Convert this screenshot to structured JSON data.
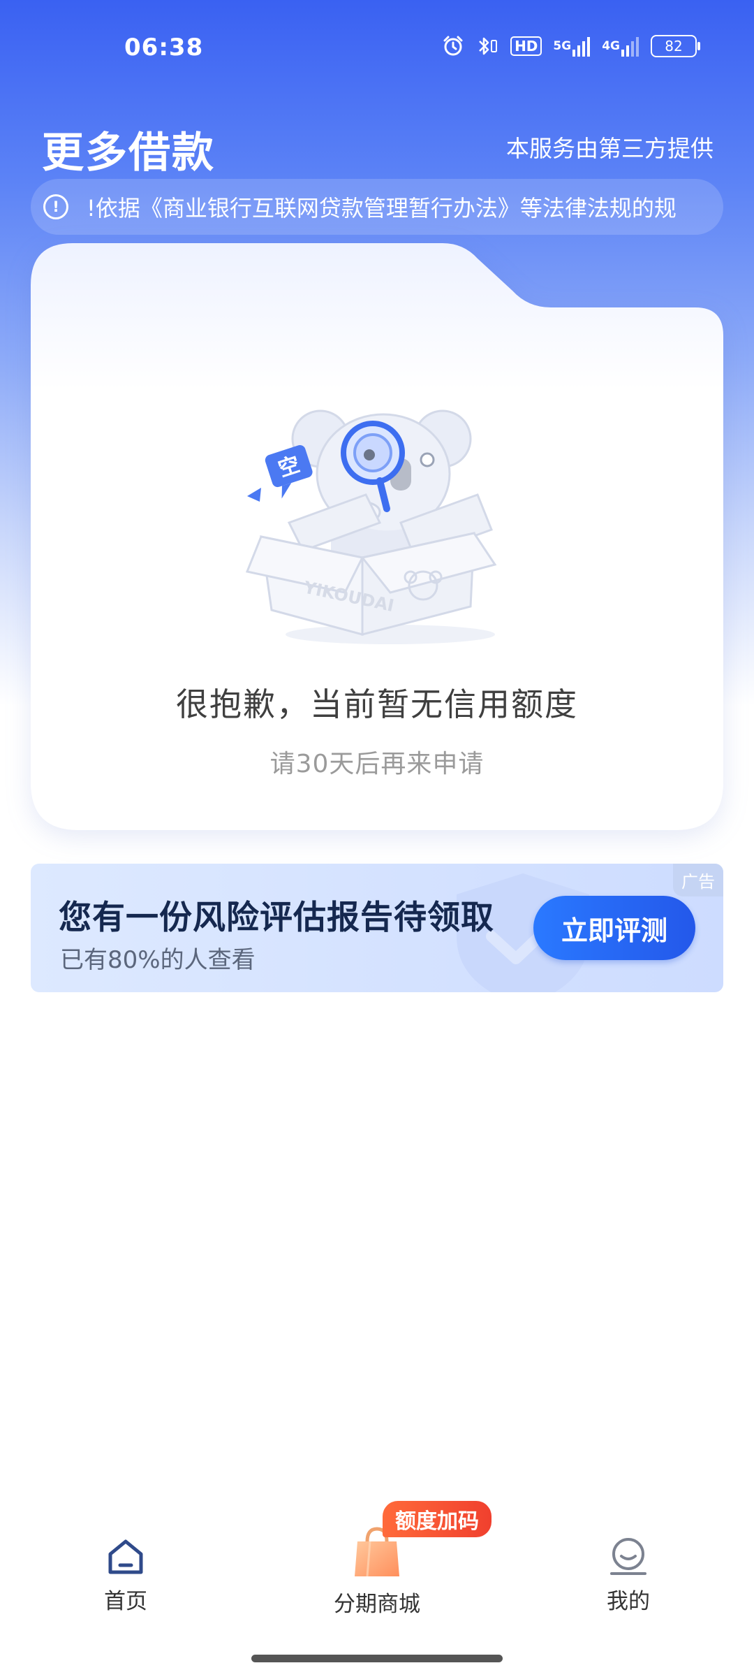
{
  "status_bar": {
    "time": "06:38",
    "hd_label": "HD",
    "signal1_label": "5G",
    "signal2_label": "4G",
    "battery_level": "82"
  },
  "header": {
    "title": "更多借款",
    "provider_note": "本服务由第三方提供"
  },
  "notice": {
    "icon": "info-circle-icon",
    "text": "!依据《商业银行互联网贷款管理暂行办法》等法律法规的规"
  },
  "empty_state": {
    "title": "很抱歉，当前暂无信用额度",
    "subtitle": "请30天后再来申请",
    "box_brand": "YIKOUDAI",
    "bubble_text": "空"
  },
  "ad": {
    "title": "您有一份风险评估报告待领取",
    "subtitle": "已有80%的人查看",
    "button_label": "立即评测",
    "tag": "广告"
  },
  "bottom_nav": {
    "items": [
      {
        "label": "首页",
        "icon": "home-icon"
      },
      {
        "label": "分期商城",
        "icon": "shopping-bag-icon"
      },
      {
        "label": "我的",
        "icon": "profile-icon"
      }
    ],
    "promo_badge": "额度加码"
  },
  "colors": {
    "brand_blue": "#3a61f2",
    "button_blue": "#2458ea",
    "badge_red": "#f0402e"
  }
}
